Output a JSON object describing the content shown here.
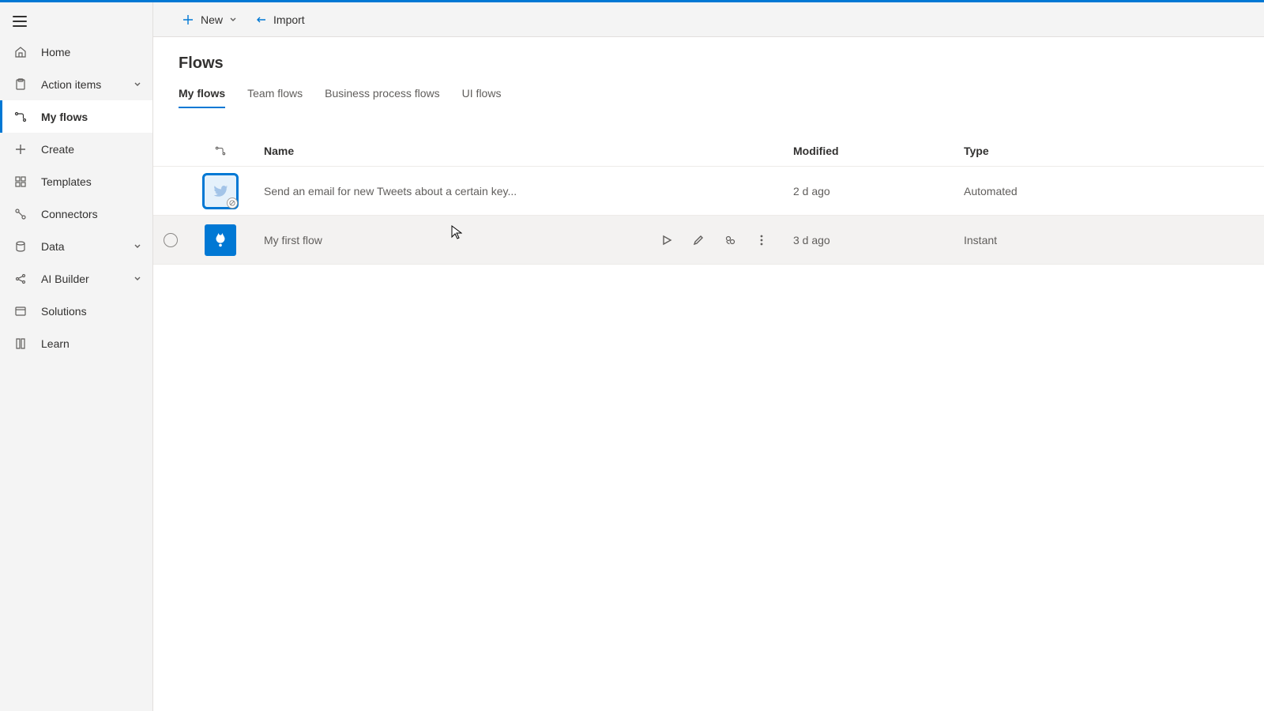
{
  "sidebar": {
    "items": [
      {
        "label": "Home"
      },
      {
        "label": "Action items"
      },
      {
        "label": "My flows"
      },
      {
        "label": "Create"
      },
      {
        "label": "Templates"
      },
      {
        "label": "Connectors"
      },
      {
        "label": "Data"
      },
      {
        "label": "AI Builder"
      },
      {
        "label": "Solutions"
      },
      {
        "label": "Learn"
      }
    ]
  },
  "commandbar": {
    "new_label": "New",
    "import_label": "Import"
  },
  "page": {
    "title": "Flows",
    "tabs": [
      {
        "label": "My flows"
      },
      {
        "label": "Team flows"
      },
      {
        "label": "Business process flows"
      },
      {
        "label": "UI flows"
      }
    ],
    "columns": {
      "name": "Name",
      "modified": "Modified",
      "type": "Type"
    },
    "rows": [
      {
        "name": "Send an email for new Tweets about a certain key...",
        "modified": "2 d ago",
        "type": "Automated"
      },
      {
        "name": "My first flow",
        "modified": "3 d ago",
        "type": "Instant"
      }
    ]
  }
}
